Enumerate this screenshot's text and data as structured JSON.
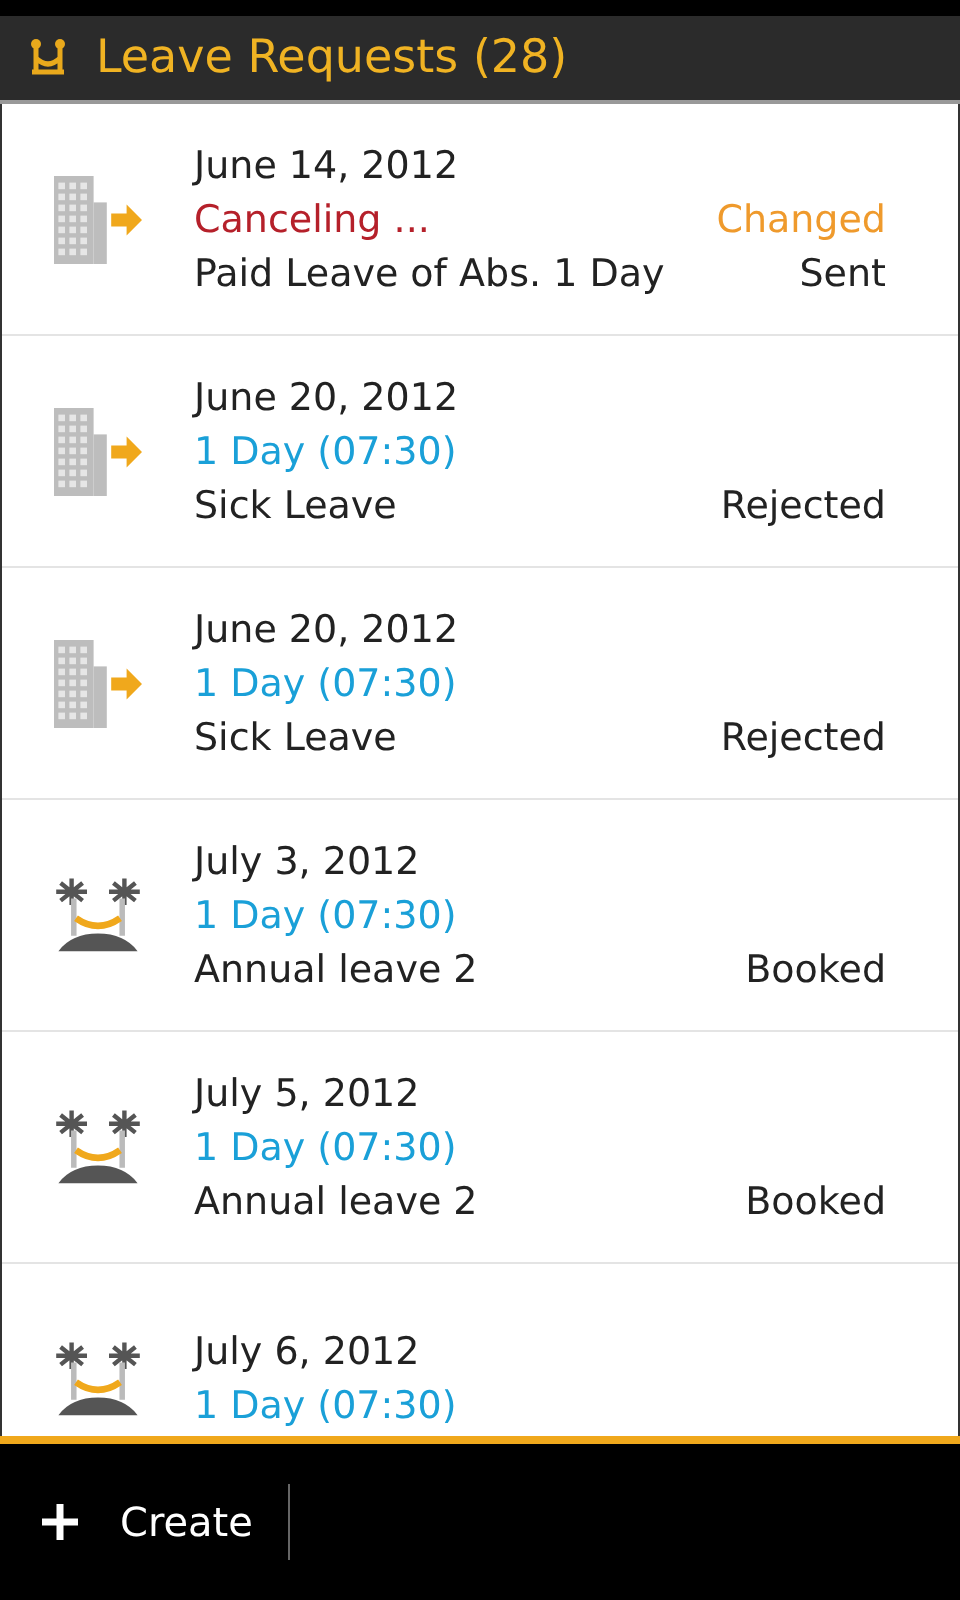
{
  "header": {
    "title": "Leave Requests (28)"
  },
  "requests": [
    {
      "kind": "office",
      "date": "June 14, 2012",
      "duration": "Canceling ...",
      "canceling": true,
      "type": "Paid Leave of Abs. 1 Day",
      "change": "Changed",
      "status": "Sent"
    },
    {
      "kind": "office",
      "date": "June 20, 2012",
      "duration": "1 Day (07:30)",
      "canceling": false,
      "type": "Sick Leave",
      "status": "Rejected"
    },
    {
      "kind": "office",
      "date": "June 20, 2012",
      "duration": "1 Day (07:30)",
      "canceling": false,
      "type": "Sick Leave",
      "status": "Rejected"
    },
    {
      "kind": "vacation",
      "date": "July 3, 2012",
      "duration": "1 Day (07:30)",
      "canceling": false,
      "type": "Annual leave 2",
      "status": "Booked"
    },
    {
      "kind": "vacation",
      "date": "July 5, 2012",
      "duration": "1 Day (07:30)",
      "canceling": false,
      "type": "Annual leave 2",
      "status": "Booked"
    },
    {
      "kind": "vacation",
      "date": "July 6, 2012",
      "duration": "1 Day (07:30)",
      "canceling": false
    }
  ],
  "action_bar": {
    "create_label": "Create"
  }
}
